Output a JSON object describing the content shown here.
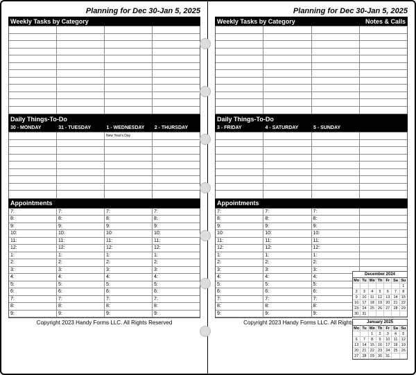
{
  "title": "Planning for Dec 30-Jan 5, 2025",
  "weekly_tasks_label": "Weekly Tasks by Category",
  "notes_calls_label": "Notes & Calls",
  "daily_things_label": "Daily Things-To-Do",
  "appointments_label": "Appointments",
  "footer": "Copyright 2023 Handy Forms LLC. All Rights Reserved",
  "left_days": [
    "30  -  MONDAY",
    "31  -  TUESDAY",
    "1  -  WEDNESDAY",
    "2  -  THURSDAY"
  ],
  "left_holiday": "New Year's Day",
  "right_days": [
    "3  -  FRIDAY",
    "4  -  SATURDAY",
    "5  -  SUNDAY"
  ],
  "appt_hours": [
    "7:",
    "8:",
    "9:",
    "10:",
    "11:",
    "12:",
    "1:",
    "2:",
    "3:",
    "4:",
    "5:",
    "6:",
    "7:",
    "8:",
    "9:"
  ],
  "minical1": {
    "title": "December 2024",
    "dow": [
      "Mo",
      "Tu",
      "We",
      "Th",
      "Fr",
      "Sa",
      "Su"
    ],
    "rows": [
      [
        "",
        "",
        "",
        "",
        "",
        "",
        "1"
      ],
      [
        "2",
        "3",
        "4",
        "5",
        "6",
        "7",
        "8"
      ],
      [
        "9",
        "10",
        "11",
        "12",
        "13",
        "14",
        "15"
      ],
      [
        "16",
        "17",
        "18",
        "19",
        "20",
        "21",
        "22"
      ],
      [
        "23",
        "24",
        "25",
        "26",
        "27",
        "28",
        "29"
      ],
      [
        "30",
        "31",
        "",
        "",
        "",
        "",
        ""
      ]
    ]
  },
  "minical2": {
    "title": "January 2025",
    "dow": [
      "Mo",
      "Tu",
      "We",
      "Th",
      "Fr",
      "Sa",
      "Su"
    ],
    "rows": [
      [
        "",
        "",
        "1",
        "2",
        "3",
        "4",
        "5"
      ],
      [
        "6",
        "7",
        "8",
        "9",
        "10",
        "11",
        "12"
      ],
      [
        "13",
        "14",
        "15",
        "16",
        "17",
        "18",
        "19"
      ],
      [
        "20",
        "21",
        "22",
        "23",
        "24",
        "25",
        "26"
      ],
      [
        "27",
        "28",
        "29",
        "30",
        "31",
        "",
        ""
      ]
    ]
  }
}
